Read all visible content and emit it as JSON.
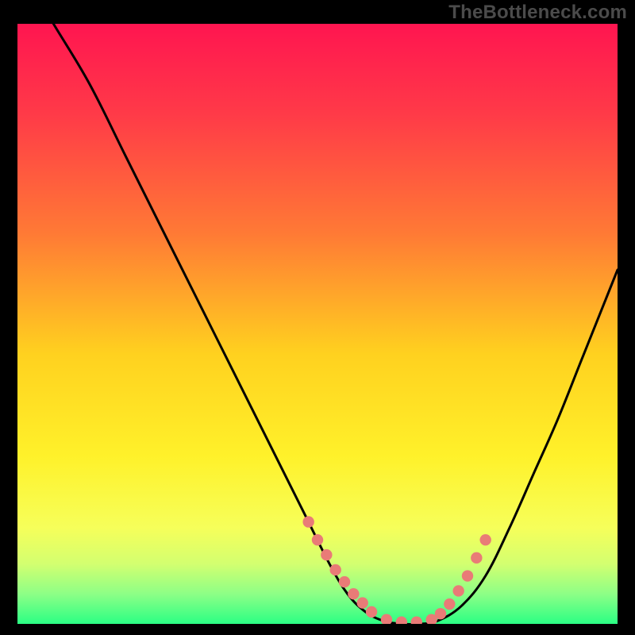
{
  "watermark": "TheBottleneck.com",
  "colors": {
    "gradient_stops": [
      {
        "offset": 0.0,
        "color": "#ff1550"
      },
      {
        "offset": 0.15,
        "color": "#ff3a48"
      },
      {
        "offset": 0.35,
        "color": "#ff7a35"
      },
      {
        "offset": 0.55,
        "color": "#ffd11f"
      },
      {
        "offset": 0.72,
        "color": "#fff12a"
      },
      {
        "offset": 0.84,
        "color": "#f6ff5a"
      },
      {
        "offset": 0.9,
        "color": "#d3ff70"
      },
      {
        "offset": 0.95,
        "color": "#8dff86"
      },
      {
        "offset": 1.0,
        "color": "#2bff84"
      }
    ],
    "curve": "#000000",
    "dots": "#e97b77",
    "frame_bg": "#000000"
  },
  "chart_data": {
    "type": "line",
    "title": "",
    "xlabel": "",
    "ylabel": "",
    "xlim": [
      0,
      100
    ],
    "ylim": [
      0,
      100
    ],
    "series": [
      {
        "name": "bottleneck-curve",
        "x": [
          0,
          6,
          12,
          18,
          24,
          30,
          36,
          42,
          48,
          52,
          55,
          58,
          61,
          64,
          67,
          70,
          74,
          78,
          82,
          86,
          90,
          94,
          98,
          100
        ],
        "y": [
          110,
          100,
          90,
          78,
          66,
          54,
          42,
          30,
          18,
          10,
          5,
          2,
          0.5,
          0,
          0,
          0.5,
          3,
          8,
          16,
          25,
          34,
          44,
          54,
          59
        ]
      }
    ],
    "highlight_dots": {
      "name": "sweet-spot-dots",
      "x": [
        48.5,
        50,
        51.5,
        53,
        54.5,
        56,
        57.5,
        59,
        61.5,
        64,
        66.5,
        69,
        70.5,
        72,
        73.5,
        75,
        76.5,
        78
      ],
      "y": [
        17,
        14,
        11.5,
        9,
        7,
        5,
        3.5,
        2,
        0.7,
        0.3,
        0.3,
        0.7,
        1.7,
        3.3,
        5.5,
        8,
        11,
        14
      ]
    }
  }
}
